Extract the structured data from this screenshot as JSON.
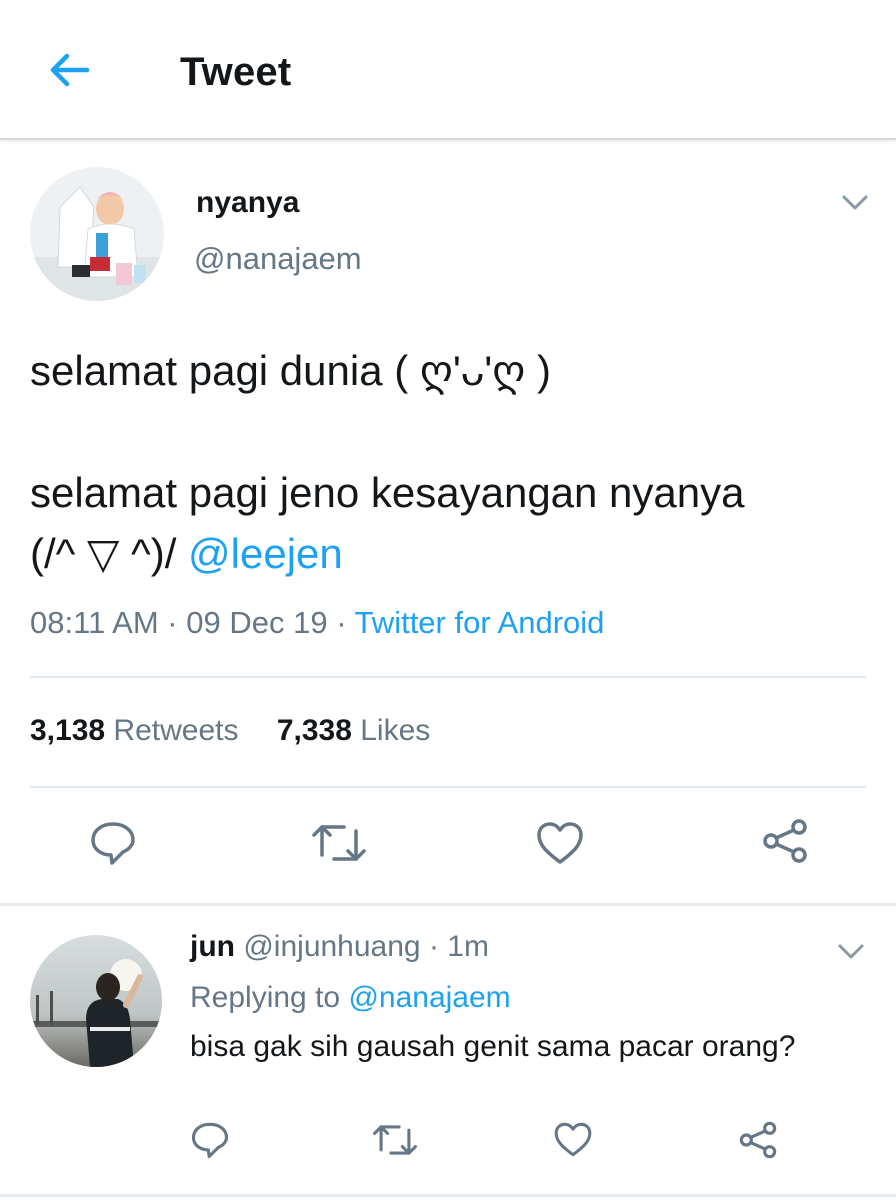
{
  "header": {
    "title": "Tweet"
  },
  "colors": {
    "accent": "#1da1f2",
    "secondary_text": "#657786",
    "primary_text": "#14171a",
    "divider": "#e1e8ed"
  },
  "icons": {
    "back": "arrow-left-icon",
    "caret": "chevron-down-icon",
    "reply": "reply-icon",
    "retweet": "retweet-icon",
    "like": "heart-icon",
    "share": "share-icon"
  },
  "tweet": {
    "author": {
      "display_name": "nyanya",
      "handle": "@nanajaem"
    },
    "text_line1": "selamat pagi dunia ( ღ'ᴗ'ღ )",
    "text_line2": "selamat pagi jeno kesayangan nyanya",
    "text_line3": "(/^ ▽ ^)/ ",
    "mention": "@leejen",
    "time": "08:11 AM",
    "date": "09 Dec 19",
    "separator": " · ",
    "source": "Twitter for Android",
    "stats": {
      "retweets_count": "3,138",
      "retweets_label": "Retweets",
      "likes_count": "7,338",
      "likes_label": "Likes"
    }
  },
  "reply": {
    "display_name": "jun",
    "handle": "@injunhuang",
    "separator": " · ",
    "time": "1m",
    "replying_label": "Replying to ",
    "replying_to": "@nanajaem",
    "text": "bisa gak sih gausah genit sama pacar orang?"
  }
}
